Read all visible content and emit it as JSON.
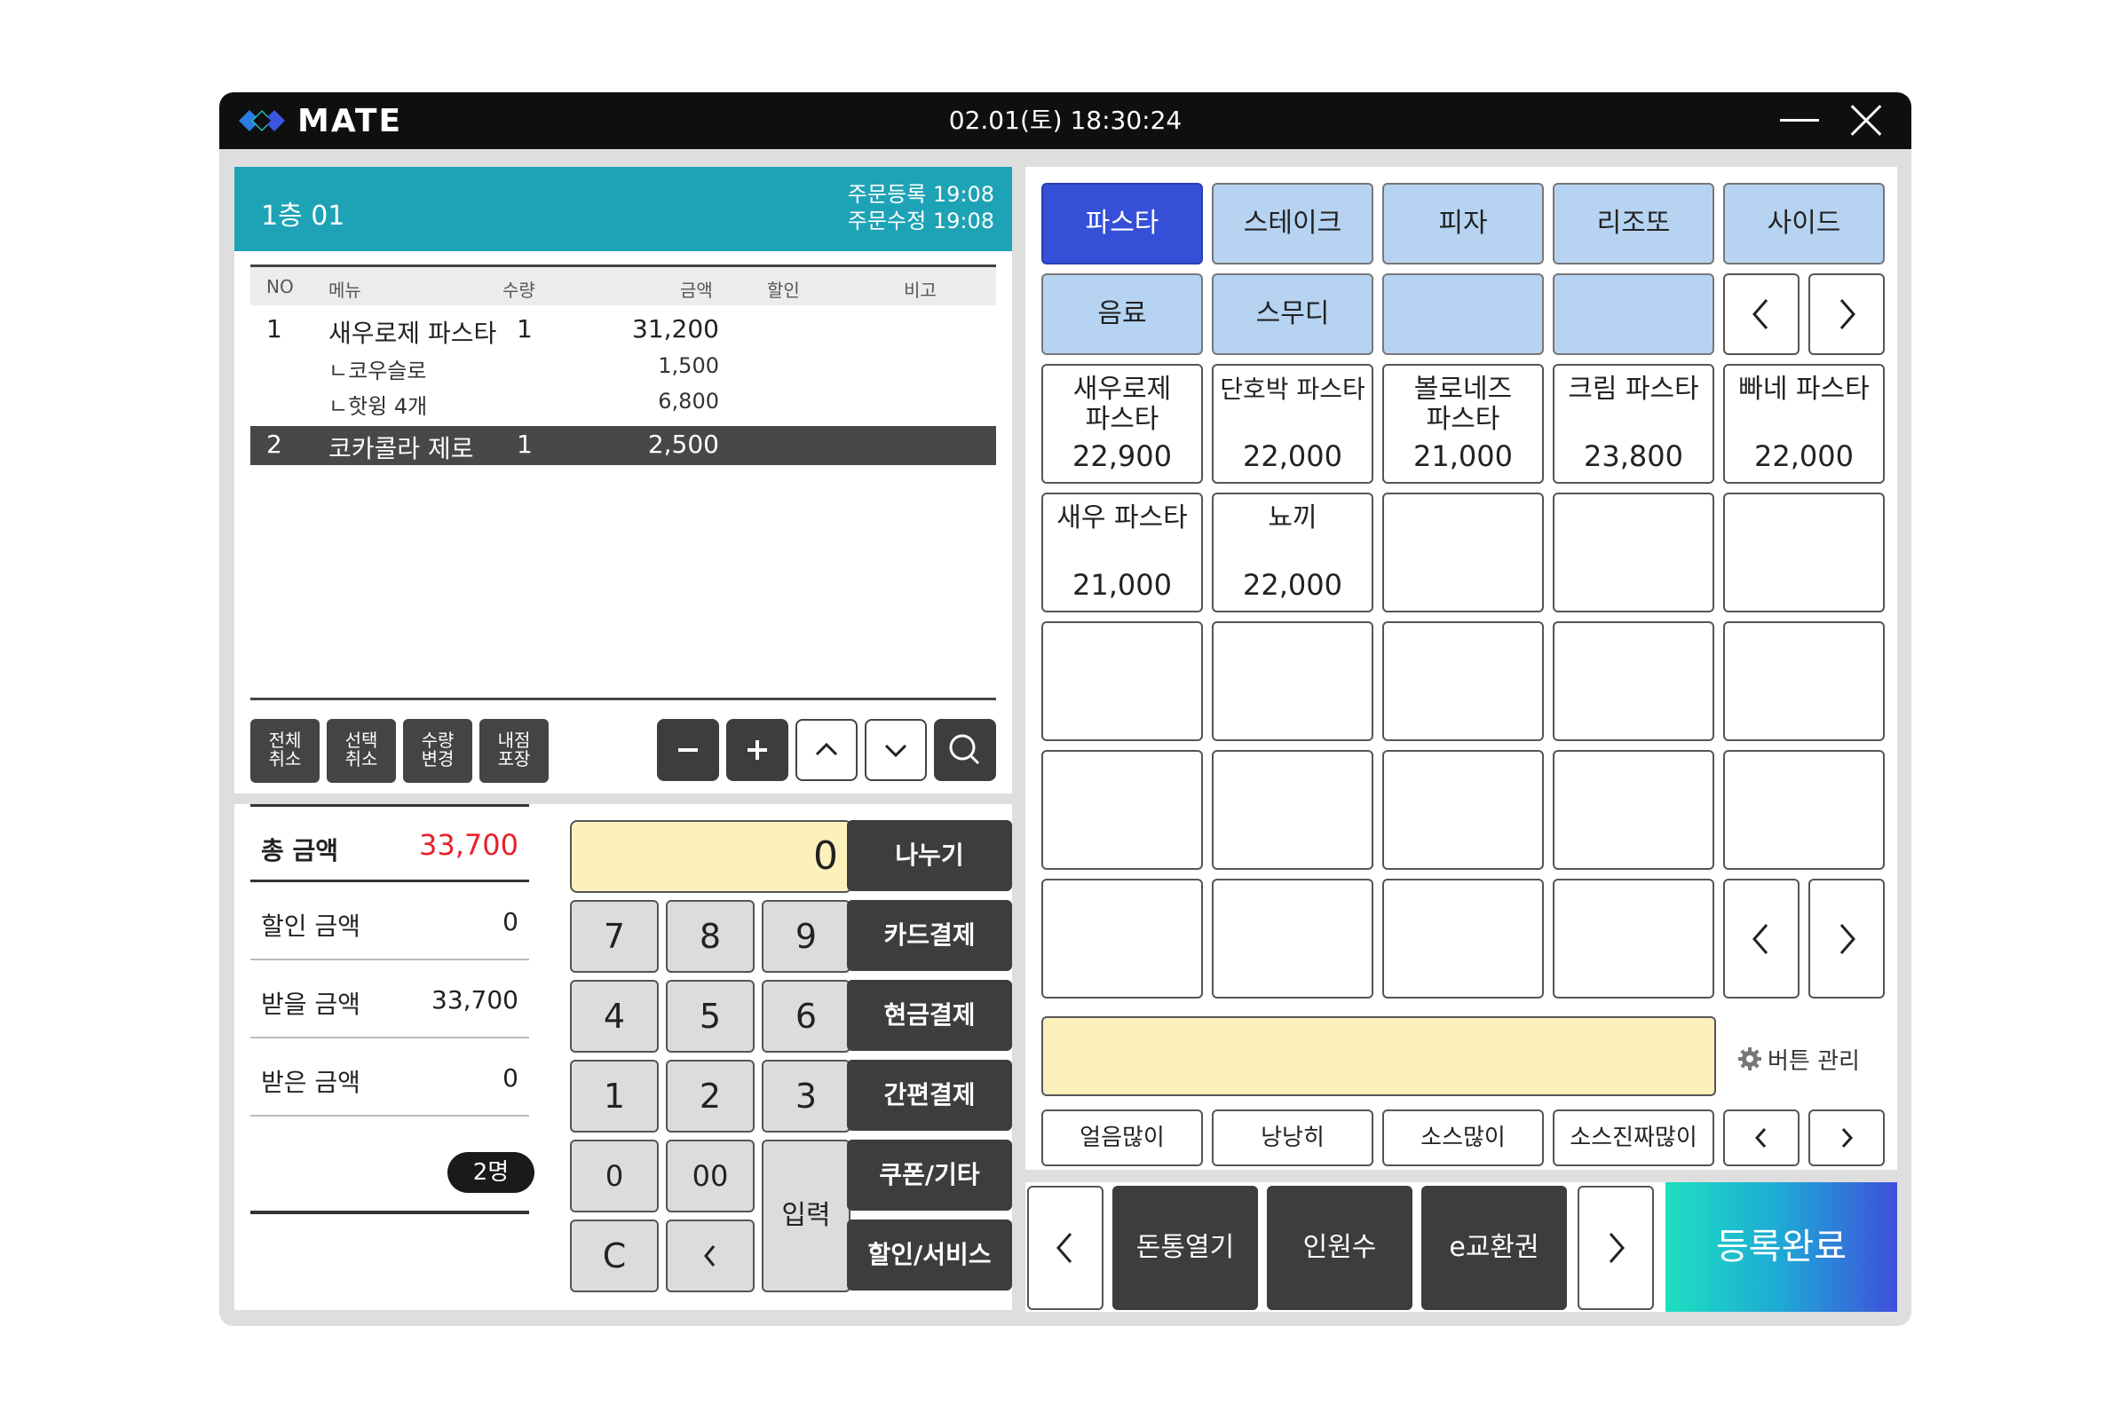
{
  "app": {
    "logo_text": "MATE",
    "datetime": "02.01(토) 18:30:24"
  },
  "order": {
    "table_name": "1층 01",
    "registered": "주문등록 19:08",
    "modified": "주문수정 19:08",
    "columns": {
      "no": "NO",
      "menu": "메뉴",
      "qty": "수량",
      "amount": "금액",
      "discount": "할인",
      "note": "비고"
    },
    "rows": [
      {
        "no": "1",
        "menu": "새우로제 파스타",
        "qty": "1",
        "amount": "31,200"
      },
      {
        "menu": "ㄴ코우슬로",
        "amount": "1,500"
      },
      {
        "menu": "ㄴ핫윙 4개",
        "amount": "6,800"
      },
      {
        "no": "2",
        "menu": "코카콜라 제로",
        "qty": "1",
        "amount": "2,500"
      }
    ],
    "actions": [
      "전체\n취소",
      "선택\n취소",
      "수량\n변경",
      "내점\n포장"
    ]
  },
  "payment": {
    "total_label": "총 금액",
    "total_value": "33,700",
    "discount_label": "할인 금액",
    "discount_value": "0",
    "due_label": "받을 금액",
    "due_value": "33,700",
    "received_label": "받은 금액",
    "received_value": "0",
    "guests": "2명",
    "display_value": "0",
    "keys": [
      "7",
      "8",
      "9",
      "4",
      "5",
      "6",
      "1",
      "2",
      "3",
      "0",
      "00",
      "C"
    ],
    "enter_label": "입력",
    "buttons": [
      "나누기",
      "카드결제",
      "현금결제",
      "간편결제",
      "쿠폰/기타",
      "할인/서비스"
    ]
  },
  "menu": {
    "categories": [
      "파스타",
      "스테이크",
      "피자",
      "리조또",
      "사이드",
      "음료",
      "스무디",
      "",
      ""
    ],
    "items": [
      {
        "name": "새우로제\n파스타",
        "price": "22,900"
      },
      {
        "name": "단호박 파스타",
        "price": "22,000"
      },
      {
        "name": "볼로네즈\n파스타",
        "price": "21,000"
      },
      {
        "name": "크림 파스타",
        "price": "23,800"
      },
      {
        "name": "빠네 파스타",
        "price": "22,000"
      },
      {
        "name": "새우 파스타",
        "price": "21,000"
      },
      {
        "name": "뇨끼",
        "price": "22,000"
      }
    ],
    "button_manage": "버튼 관리",
    "memos": [
      "얼음많이",
      "낭낭히",
      "소스많이",
      "소스진짜많이"
    ]
  },
  "actions": {
    "buttons": [
      "돈통열기",
      "인원수",
      "e교환권"
    ],
    "register": "등록완료"
  },
  "colors": {
    "accent_teal": "#1ea3b6",
    "active_category": "#3550d7",
    "category": "#b6d3f1",
    "total_red": "#e8212b",
    "memo_yellow": "#fdf1bb"
  }
}
